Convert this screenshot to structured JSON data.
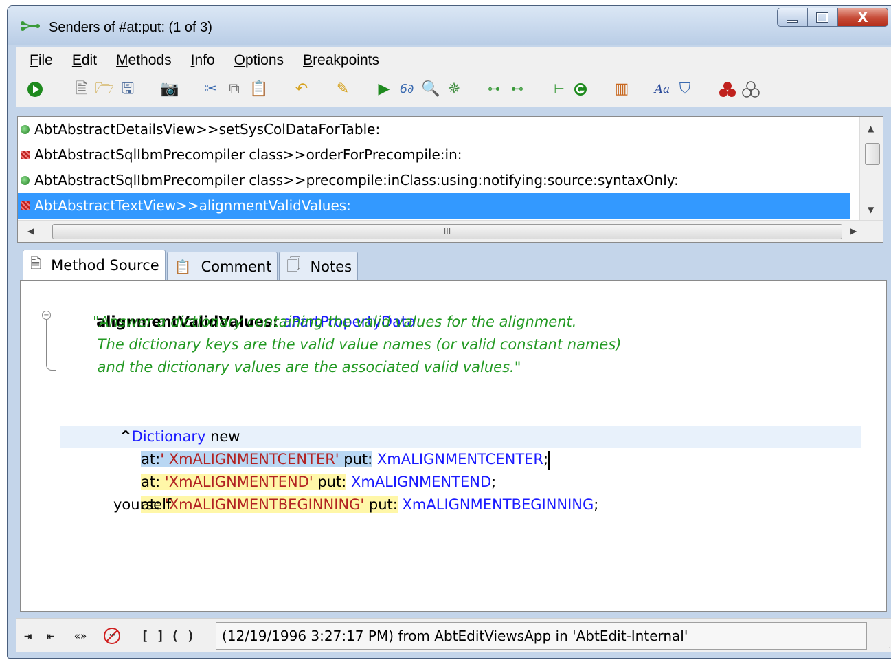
{
  "window": {
    "title": "Senders of #at:put: (1 of 3)",
    "controls": {
      "minimize": "minimize",
      "maximize": "maximize",
      "close": "X"
    }
  },
  "menu": [
    {
      "key": "F",
      "rest": "ile"
    },
    {
      "key": "E",
      "rest": "dit"
    },
    {
      "key": "M",
      "rest": "ethods"
    },
    {
      "key": "I",
      "rest": "nfo"
    },
    {
      "key": "O",
      "rest": "ptions"
    },
    {
      "key": "B",
      "rest": "reakpoints"
    }
  ],
  "toolbar": {
    "icons": [
      "run-icon",
      "new-icon",
      "open-folder-icon",
      "save-icon",
      "camera-icon",
      "cut-icon",
      "copy-icon",
      "paste-icon",
      "undo-icon",
      "highlight-icon",
      "execute-icon",
      "inspect-icon",
      "find-icon",
      "debug-icon",
      "senders-icon",
      "implementors-icon",
      "hierarchy-icon",
      "browse-icon",
      "columns-icon",
      "font-icon",
      "paint-icon",
      "red-group-icon",
      "outline-group-icon"
    ]
  },
  "methods": {
    "rows": [
      {
        "text": "AbtAbstractDetailsView>>setSysColDataForTable:",
        "icon": "green"
      },
      {
        "text": "AbtAbstractSqlIbmPrecompiler class>>orderForPrecompile:in:",
        "icon": "red"
      },
      {
        "text": "AbtAbstractSqlIbmPrecompiler class>>precompile:inClass:using:notifying:source:syntaxOnly:",
        "icon": "green"
      },
      {
        "text": "AbtAbstractTextView>>alignmentValidValues:",
        "icon": "red",
        "selected": true
      }
    ],
    "hscroll_grip": "III"
  },
  "tabs": {
    "method_source": "Method Source",
    "comment": "Comment",
    "notes": "Notes"
  },
  "source": {
    "selector": "alignmentValidValues:",
    "argument": "aPartPropertyData",
    "comment_lines": [
      "\"Answer a dictionary containing the valid values for the alignment.",
      " The dictionary keys are the valid value names (or valid constant names)",
      " and the dictionary values are the associated valid values.\""
    ],
    "caret_symbol": "^",
    "class_name": "Dictionary",
    "new_msg": "new",
    "line1": {
      "at": "at:",
      "key": "' XmALIGNMENTCENTER'",
      "put": "put:",
      "value": "XmALIGNMENTCENTER",
      "end": ";"
    },
    "line2": {
      "at": "at: ",
      "key": "'XmALIGNMENTEND'",
      "put": "put:",
      "value": "XmALIGNMENTEND",
      "end": ";"
    },
    "line3": {
      "at": "at: ",
      "key": "'XmALIGNMENTBEGINNING'",
      "put": "put:",
      "value": "XmALIGNMENTBEGINNING",
      "end": ";"
    },
    "yourself": "yourself"
  },
  "status": {
    "text": "(12/19/1996 3:27:17 PM) from AbtEditViewsApp in 'AbtEdit-Internal'",
    "icons": [
      "indent-icon",
      "outdent-icon",
      "quote-icon",
      "no-comment-icon",
      "brackets-icon",
      "parens-icon"
    ],
    "quote_glyph": "«»",
    "brackets_glyph": "[ ]",
    "parens_glyph": "( )"
  },
  "colors": {
    "selection": "#3399ff",
    "comment": "#229922",
    "keyword_blue": "#1a1aff",
    "string": "#b22222",
    "highlight_yellow": "#fff7a8"
  }
}
